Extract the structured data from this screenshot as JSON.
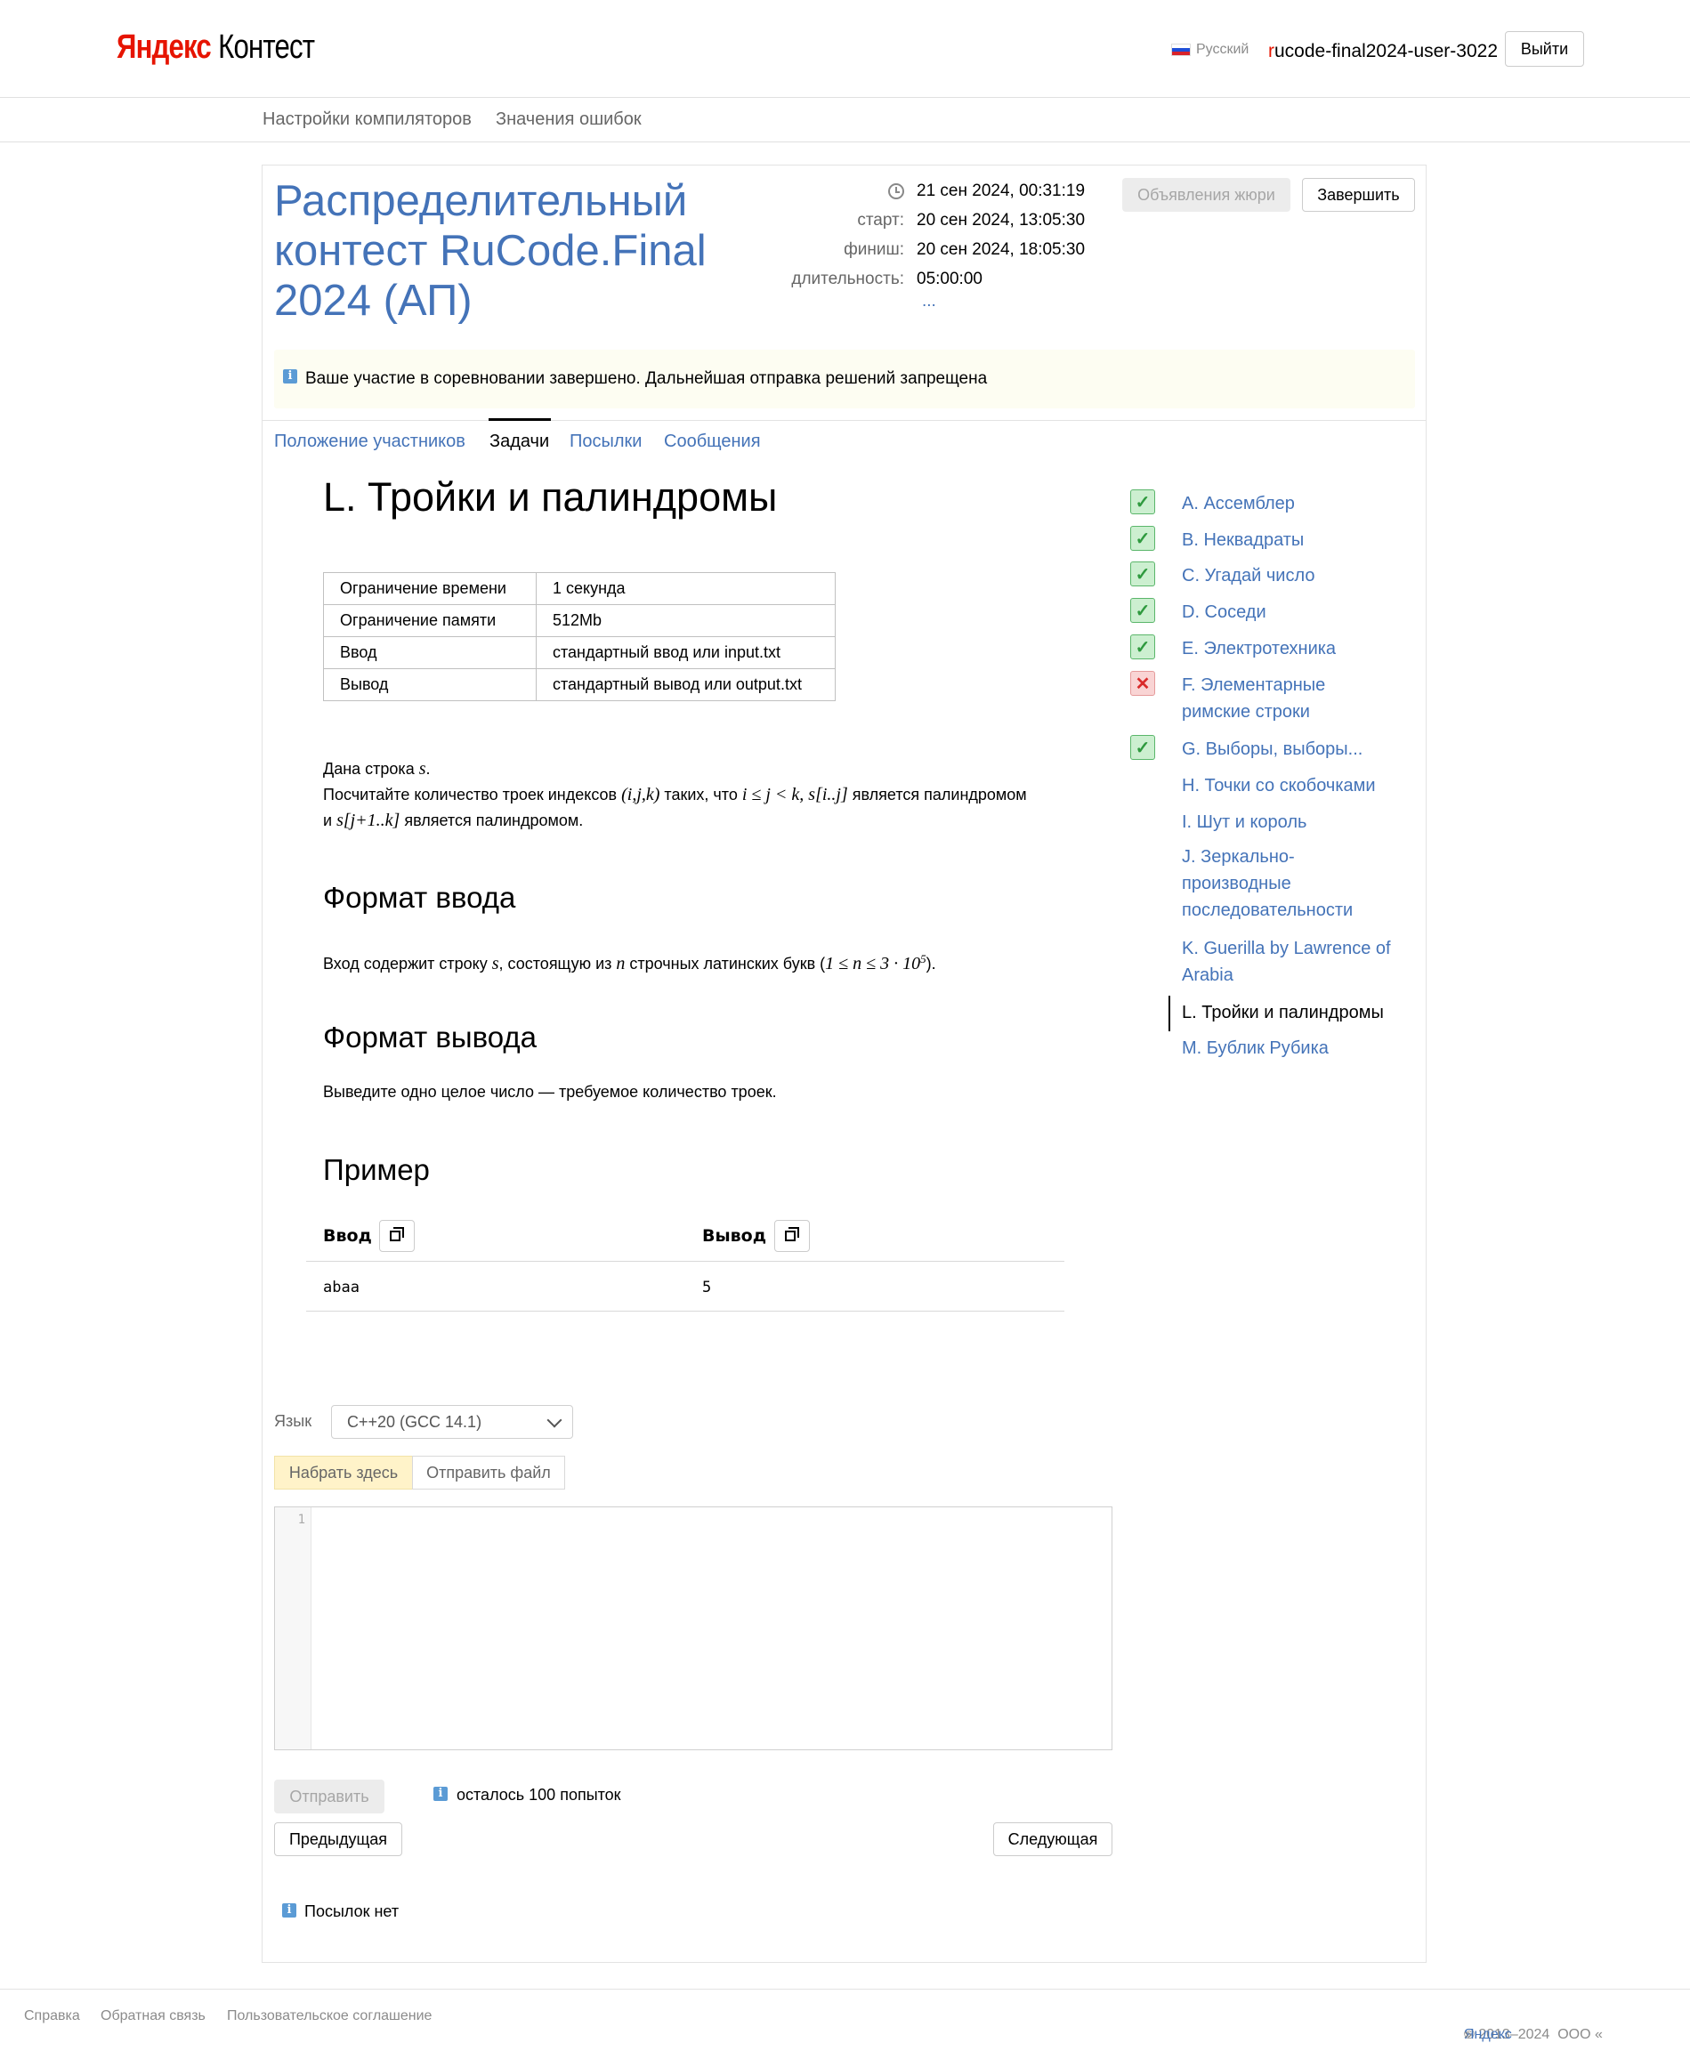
{
  "header": {
    "logo_ya": "Яндекс",
    "logo_product": "Контест",
    "language": "Русский",
    "user_first": "r",
    "user_rest": "ucode-final2024-user-3022",
    "logout": "Выйти"
  },
  "subnav": [
    "Настройки компиляторов",
    "Значения ошибок"
  ],
  "contest": {
    "title": "Распределительный контест RuCode.Final 2024 (АП)",
    "now": "21 сен 2024, 00:31:19",
    "start_label": "старт:",
    "start": "20 сен 2024, 13:05:30",
    "finish_label": "финиш:",
    "finish": "20 сен 2024, 18:05:30",
    "duration_label": "длительность:",
    "duration": "05:00:00",
    "more": "...",
    "jury_button": "Объявления жюри",
    "finish_button": "Завершить",
    "banner": "Ваше участие в соревновании завершено. Дальнейшая отправка решений запрещена"
  },
  "tabs": [
    "Положение участников",
    "Задачи",
    "Посылки",
    "Сообщения"
  ],
  "problem": {
    "title": "L. Тройки и палиндромы",
    "limits": [
      [
        "Ограничение времени",
        "1 секунда"
      ],
      [
        "Ограничение памяти",
        "512Mb"
      ],
      [
        "Ввод",
        "стандартный ввод или input.txt"
      ],
      [
        "Вывод",
        "стандартный вывод или output.txt"
      ]
    ],
    "stmt1": "Дана строка ",
    "stmt1_var": "s",
    "stmt1_end": ".",
    "stmt2_a": "Посчитайте количество троек индексов ",
    "stmt2_m1": "(i,j,k)",
    "stmt2_b": " таких, что ",
    "stmt2_m2": "i ≤ j < k, s[i..j]",
    "stmt2_c": " является палиндромом",
    "stmt3_a": "и ",
    "stmt3_m": "s[j+1..k]",
    "stmt3_b": " является палиндромом.",
    "input_heading": "Формат ввода",
    "input_a": "Вход содержит строку ",
    "input_m1": "s",
    "input_b": ", состоящую из ",
    "input_m2": "n",
    "input_c": " строчных латинских букв (",
    "input_m3": "1 ≤ n ≤ 3 · 10",
    "input_sup": "5",
    "input_d": ").",
    "output_heading": "Формат вывода",
    "output_text": "Выведите одно целое число — требуемое количество троек.",
    "example_heading": "Пример",
    "ex_in_label": "Ввод",
    "ex_out_label": "Вывод",
    "ex_in": "abaa",
    "ex_out": "5"
  },
  "sidebar": [
    {
      "label": "A. Ассемблер",
      "status": "ok"
    },
    {
      "label": "B. Неквадраты",
      "status": "ok"
    },
    {
      "label": "C. Угадай число",
      "status": "ok"
    },
    {
      "label": "D. Соседи",
      "status": "ok"
    },
    {
      "label": "E. Электротехника",
      "status": "ok"
    },
    {
      "label": "F. Элементарные римские строки",
      "status": "fail"
    },
    {
      "label": "G. Выборы, выборы...",
      "status": "ok"
    },
    {
      "label": "H. Точки со скобочками",
      "status": ""
    },
    {
      "label": "I. Шут и король",
      "status": ""
    },
    {
      "label": "J. Зеркально-производные последовательности",
      "status": ""
    },
    {
      "label": "K. Guerilla by Lawrence of Arabia",
      "status": ""
    },
    {
      "label": "L. Тройки и палиндромы",
      "status": "current"
    },
    {
      "label": "M. Бублик Рубика",
      "status": ""
    }
  ],
  "submit": {
    "lang_label": "Язык",
    "lang_value": "C++20 (GCC 14.1)",
    "type_here": "Набрать здесь",
    "send_file": "Отправить файл",
    "line_no": "1",
    "send": "Отправить",
    "attempts": "осталось 100 попыток",
    "prev": "Предыдущая",
    "next": "Следующая",
    "no_submissions": "Посылок нет"
  },
  "footer": {
    "help": "Справка",
    "feedback": "Обратная связь",
    "agreement": "Пользовательское соглашение",
    "copyright_a": "© 2013–2024  ООО «",
    "copyright_link": "Яндекс",
    "copyright_b": "»"
  }
}
